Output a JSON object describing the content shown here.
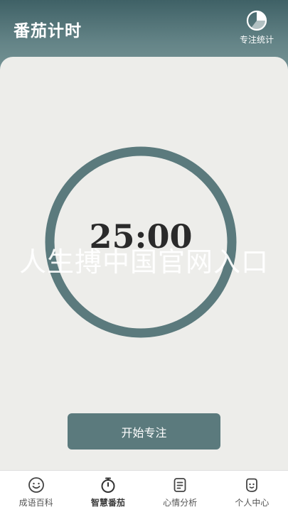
{
  "header": {
    "title": "番茄计时",
    "stats_label": "专注统计",
    "stats_icon": "pie-chart-icon"
  },
  "timer": {
    "display": "25:00",
    "ring_color": "#5b7a7d"
  },
  "watermark": "人生搏中国官网入口",
  "start_button": {
    "label": "开始专注"
  },
  "tabs": [
    {
      "label": "成语百科",
      "icon": "smile-icon",
      "active": false
    },
    {
      "label": "智慧番茄",
      "icon": "stopwatch-icon",
      "active": true
    },
    {
      "label": "心情分析",
      "icon": "notes-icon",
      "active": false
    },
    {
      "label": "个人中心",
      "icon": "face-icon",
      "active": false
    }
  ],
  "colors": {
    "accent": "#5b7a7d",
    "background": "#ededea",
    "header_top": "#3f6166"
  }
}
